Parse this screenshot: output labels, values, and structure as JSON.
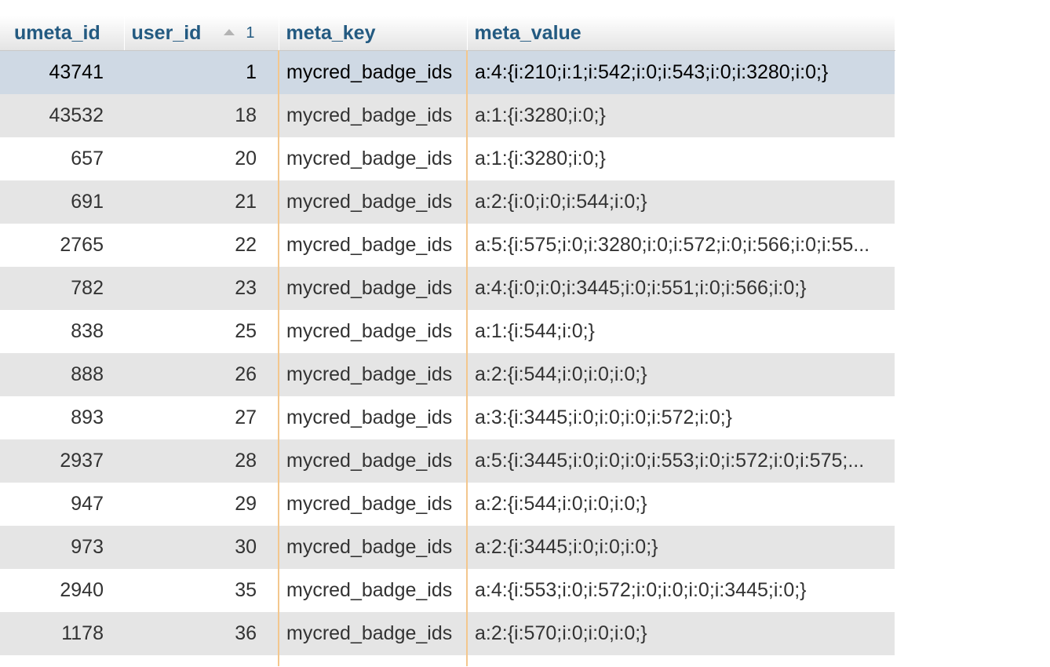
{
  "columns": {
    "umeta_id": "umeta_id",
    "user_id": "user_id",
    "user_id_sort_order": "1",
    "meta_key": "meta_key",
    "meta_value": "meta_value"
  },
  "icons": {
    "sort": "sort-ascending-icon"
  },
  "colors": {
    "header_text": "#235a81",
    "highlight_row": "#cfd9e4",
    "stripe_row": "#e5e5e5",
    "column_marker": "#f3c78e"
  },
  "rows": [
    {
      "umeta_id": "43741",
      "user_id": "1",
      "meta_key": "mycred_badge_ids",
      "meta_value": "a:4:{i:210;i:1;i:542;i:0;i:543;i:0;i:3280;i:0;}"
    },
    {
      "umeta_id": "43532",
      "user_id": "18",
      "meta_key": "mycred_badge_ids",
      "meta_value": "a:1:{i:3280;i:0;}"
    },
    {
      "umeta_id": "657",
      "user_id": "20",
      "meta_key": "mycred_badge_ids",
      "meta_value": "a:1:{i:3280;i:0;}"
    },
    {
      "umeta_id": "691",
      "user_id": "21",
      "meta_key": "mycred_badge_ids",
      "meta_value": "a:2:{i:0;i:0;i:544;i:0;}"
    },
    {
      "umeta_id": "2765",
      "user_id": "22",
      "meta_key": "mycred_badge_ids",
      "meta_value": "a:5:{i:575;i:0;i:3280;i:0;i:572;i:0;i:566;i:0;i:55..."
    },
    {
      "umeta_id": "782",
      "user_id": "23",
      "meta_key": "mycred_badge_ids",
      "meta_value": "a:4:{i:0;i:0;i:3445;i:0;i:551;i:0;i:566;i:0;}"
    },
    {
      "umeta_id": "838",
      "user_id": "25",
      "meta_key": "mycred_badge_ids",
      "meta_value": "a:1:{i:544;i:0;}"
    },
    {
      "umeta_id": "888",
      "user_id": "26",
      "meta_key": "mycred_badge_ids",
      "meta_value": "a:2:{i:544;i:0;i:0;i:0;}"
    },
    {
      "umeta_id": "893",
      "user_id": "27",
      "meta_key": "mycred_badge_ids",
      "meta_value": "a:3:{i:3445;i:0;i:0;i:0;i:572;i:0;}"
    },
    {
      "umeta_id": "2937",
      "user_id": "28",
      "meta_key": "mycred_badge_ids",
      "meta_value": "a:5:{i:3445;i:0;i:0;i:0;i:553;i:0;i:572;i:0;i:575;..."
    },
    {
      "umeta_id": "947",
      "user_id": "29",
      "meta_key": "mycred_badge_ids",
      "meta_value": "a:2:{i:544;i:0;i:0;i:0;}"
    },
    {
      "umeta_id": "973",
      "user_id": "30",
      "meta_key": "mycred_badge_ids",
      "meta_value": "a:2:{i:3445;i:0;i:0;i:0;}"
    },
    {
      "umeta_id": "2940",
      "user_id": "35",
      "meta_key": "mycred_badge_ids",
      "meta_value": "a:4:{i:553;i:0;i:572;i:0;i:0;i:0;i:3445;i:0;}"
    },
    {
      "umeta_id": "1178",
      "user_id": "36",
      "meta_key": "mycred_badge_ids",
      "meta_value": "a:2:{i:570;i:0;i:0;i:0;}"
    }
  ]
}
